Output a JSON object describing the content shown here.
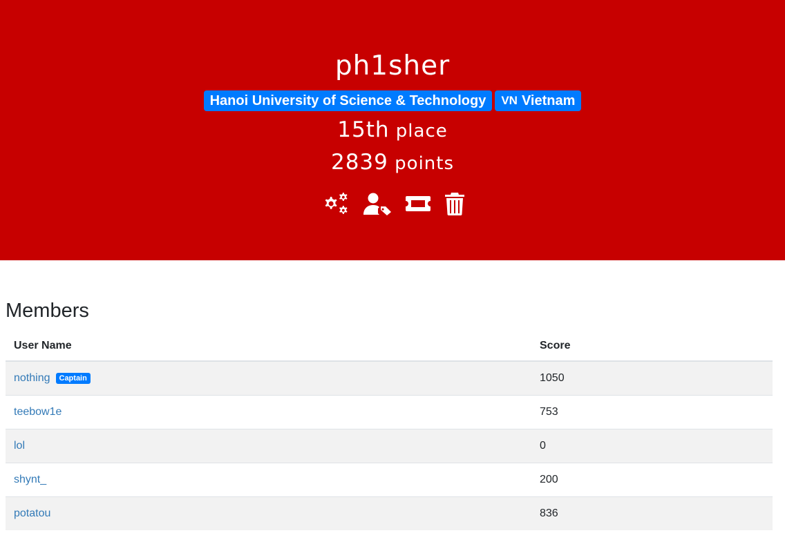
{
  "team": {
    "name": "ph1sher",
    "affiliation": "Hanoi University of Science & Technology",
    "country_code": "VN",
    "country": "Vietnam",
    "place_number": "15th",
    "place_label": "place",
    "points_number": "2839",
    "points_label": "points"
  },
  "actions": [
    {
      "icon": "settings-icon"
    },
    {
      "icon": "user-tag-icon"
    },
    {
      "icon": "ticket-icon"
    },
    {
      "icon": "trash-icon"
    }
  ],
  "members": {
    "title": "Members",
    "columns": [
      "User Name",
      "Score"
    ],
    "captain_badge": "Captain",
    "rows": [
      {
        "name": "nothing",
        "score": "1050",
        "captain": true
      },
      {
        "name": "teebow1e",
        "score": "753",
        "captain": false
      },
      {
        "name": "lol",
        "score": "0",
        "captain": false
      },
      {
        "name": "shynt_",
        "score": "200",
        "captain": false
      },
      {
        "name": "potatou",
        "score": "836",
        "captain": false
      }
    ]
  },
  "colors": {
    "jumbotron_bg": "#c70000",
    "badge_bg": "#007bff",
    "link": "#337ab7",
    "row_stripe": "#f2f2f2"
  }
}
